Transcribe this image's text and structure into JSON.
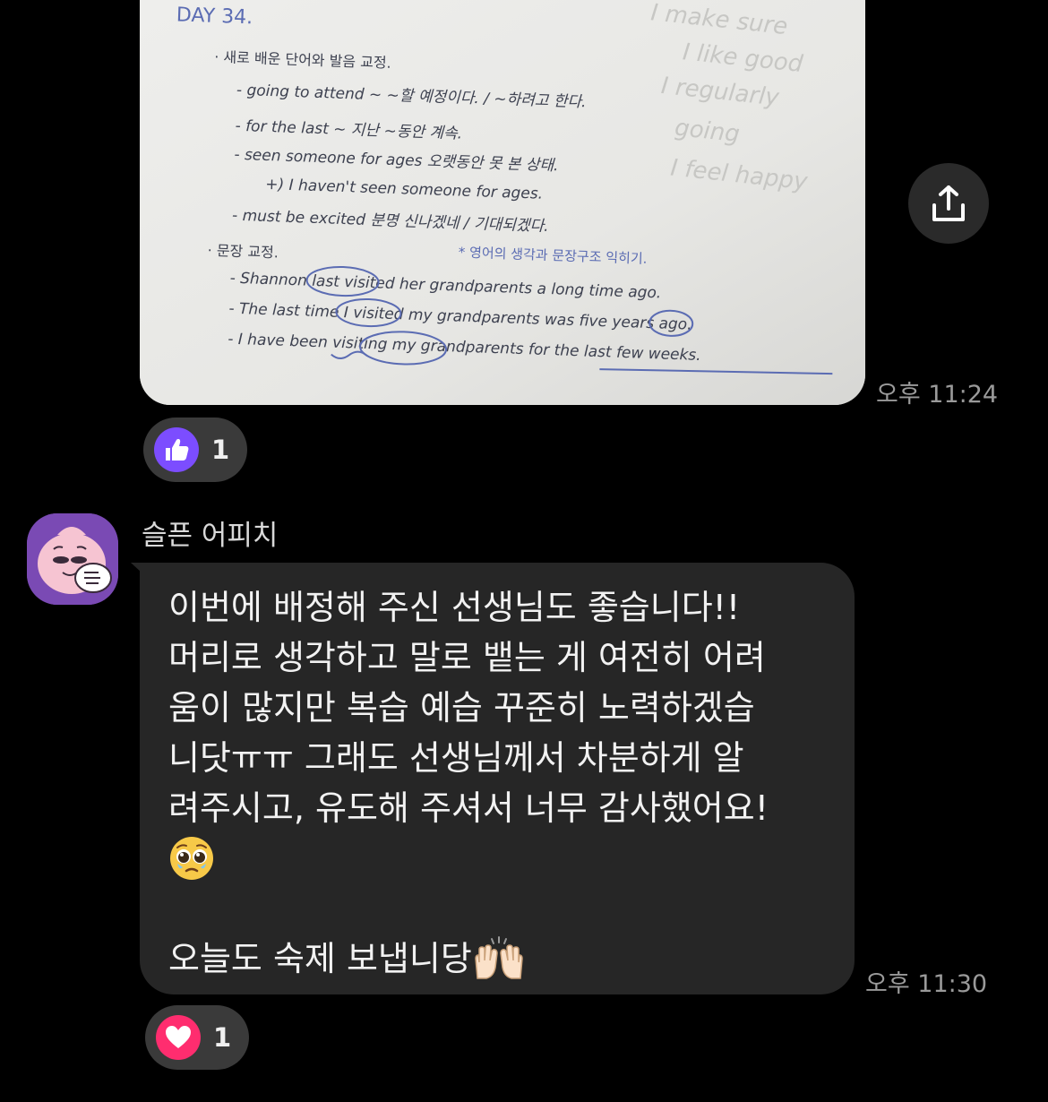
{
  "photo_message": {
    "time": "오후 11:24",
    "note_lines": [
      "DAY 34.",
      "· 새로 배운 단어와 발음 교정.",
      "- going to attend ~   ~할 예정이다. / ~하려고 한다.",
      "- for the last ~    지난 ~동안 계속.",
      "- seen someone for ages   오랫동안 못 본 상태.",
      "+) I haven't seen someone for ages.",
      "- must be excited   분명 신나겠네 / 기대되겠다.",
      "· 문장 교정.",
      "* 영어의 생각과 문장구조 익히기.",
      "- Shannon last visited her grandparents a long time ago.",
      "- The last time I visited my grandparents was five years ago.",
      "- I have been visiting my grandparents for the last few weeks."
    ],
    "ocr_icon": "text-scan-icon",
    "share_icon": "share-icon",
    "reaction": {
      "icon": "thumbs-up-icon",
      "count": "1",
      "color": "#7c4dff"
    }
  },
  "text_message": {
    "sender": "슬픈 어피치",
    "avatar_icon": "apeach-avatar",
    "lines": [
      "이번에 배정해 주신 선생님도 좋습니다!!",
      "머리로 생각하고 말로 뱉는 게 여전히 어려",
      "움이 많지만 복습 예습 꾸준히 노력하겠습",
      "니닷ㅠㅠ 그래도 선생님께서 차분하게 알",
      "려주시고, 유도해 주셔서 너무 감사했어요!",
      "",
      "",
      "오늘도 숙제 보냅니당"
    ],
    "emojis": [
      "pleading-face",
      "raising-hands"
    ],
    "time": "오후 11:30",
    "reaction": {
      "icon": "heart-icon",
      "count": "1",
      "color": "#ff2d6f"
    }
  },
  "colors": {
    "background": "#000000",
    "bubble": "#262626",
    "time": "#9a9a9a"
  }
}
